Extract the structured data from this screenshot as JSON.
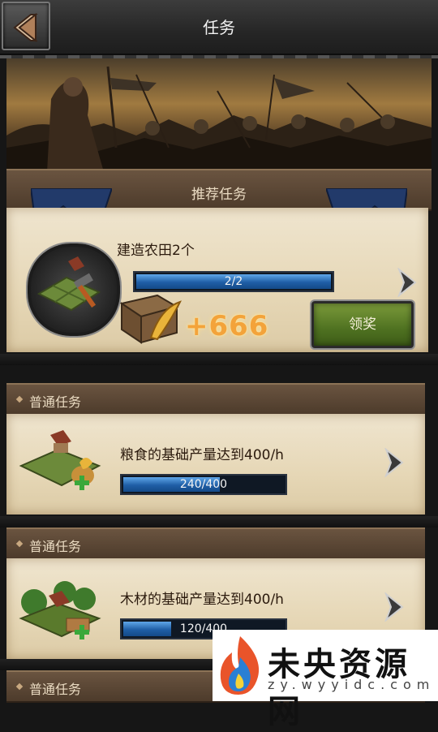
{
  "header": {
    "title": "任务"
  },
  "recommended": {
    "section_label": "推荐任务",
    "task_title": "建造农田2个",
    "progress_text": "2/2",
    "progress_fraction": 1.0,
    "reward_amount": "+666",
    "claim_label": "领奖"
  },
  "tasks": [
    {
      "section_label": "普通任务",
      "title": "粮食的基础产量达到400/h",
      "progress_text": "240/400",
      "progress_fraction": 0.6
    },
    {
      "section_label": "普通任务",
      "title": "木材的基础产量达到400/h",
      "progress_text": "120/400",
      "progress_fraction": 0.3
    },
    {
      "section_label": "普通任务"
    }
  ],
  "watermark": {
    "brand": "未央资源网",
    "domain": "zy.wyyidc.com"
  },
  "colors": {
    "progress_blue": "#1f5ea6",
    "reward_orange": "#f3a33a",
    "claim_green": "#4f7221",
    "ribbon_brown": "#4d3b2b"
  }
}
